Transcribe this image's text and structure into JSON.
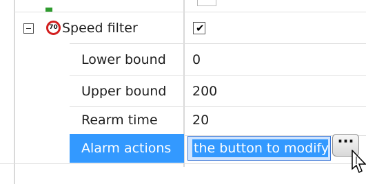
{
  "rows": [
    {
      "name": "Speed filter",
      "type": "checkbox",
      "checked": true,
      "icon": "speed-limit-70-icon",
      "icon_text": "70"
    },
    {
      "name": "Lower bound",
      "value": "0"
    },
    {
      "name": "Upper bound",
      "value": "200"
    },
    {
      "name": "Rearm time",
      "value": "20"
    },
    {
      "name": "Alarm actions",
      "value": "the button to modify",
      "button_label": "···"
    }
  ],
  "colors": {
    "selection": "#3399ff",
    "grid_line": "#d9d9d9",
    "icon_red": "#d21d1d"
  },
  "icons": {
    "expander": "collapse-minus-icon",
    "cursor": "mouse-pointer-icon",
    "checkbox": "checkmark-icon"
  }
}
